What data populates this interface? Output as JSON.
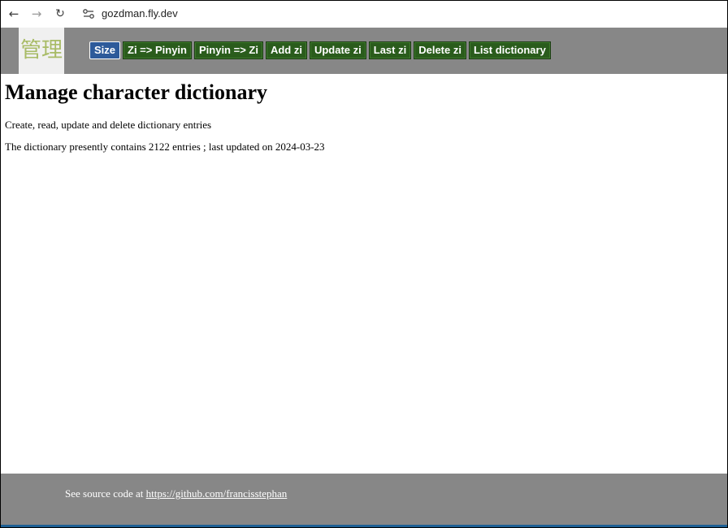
{
  "browser": {
    "url": "gozdman.fly.dev",
    "icons": {
      "back": "arrow-left-icon",
      "forward": "arrow-right-icon",
      "reload": "reload-icon",
      "site_settings": "tune-icon"
    }
  },
  "header": {
    "logo": "管理",
    "menu": [
      {
        "label": "Size",
        "active": true
      },
      {
        "label": "Zi => Pinyin",
        "active": false
      },
      {
        "label": "Pinyin => Zi",
        "active": false
      },
      {
        "label": "Add zi",
        "active": false
      },
      {
        "label": "Update zi",
        "active": false
      },
      {
        "label": "Last zi",
        "active": false
      },
      {
        "label": "Delete zi",
        "active": false
      },
      {
        "label": "List dictionary",
        "active": false
      }
    ]
  },
  "main": {
    "title": "Manage character dictionary",
    "subtitle": "Create, read, update and delete dictionary entries",
    "status_prefix": "The dictionary presently contains ",
    "entry_count": "2122",
    "status_middle": " entries ; last updated on ",
    "last_updated": "2024-03-23"
  },
  "footer": {
    "text": "See source code at ",
    "link": "https://github.com/francisstephan"
  },
  "colors": {
    "bar_gray": "#878787",
    "button_green": "#2a5c1c",
    "button_active": "#2d5a9a",
    "logo_text": "#a8bb66"
  }
}
